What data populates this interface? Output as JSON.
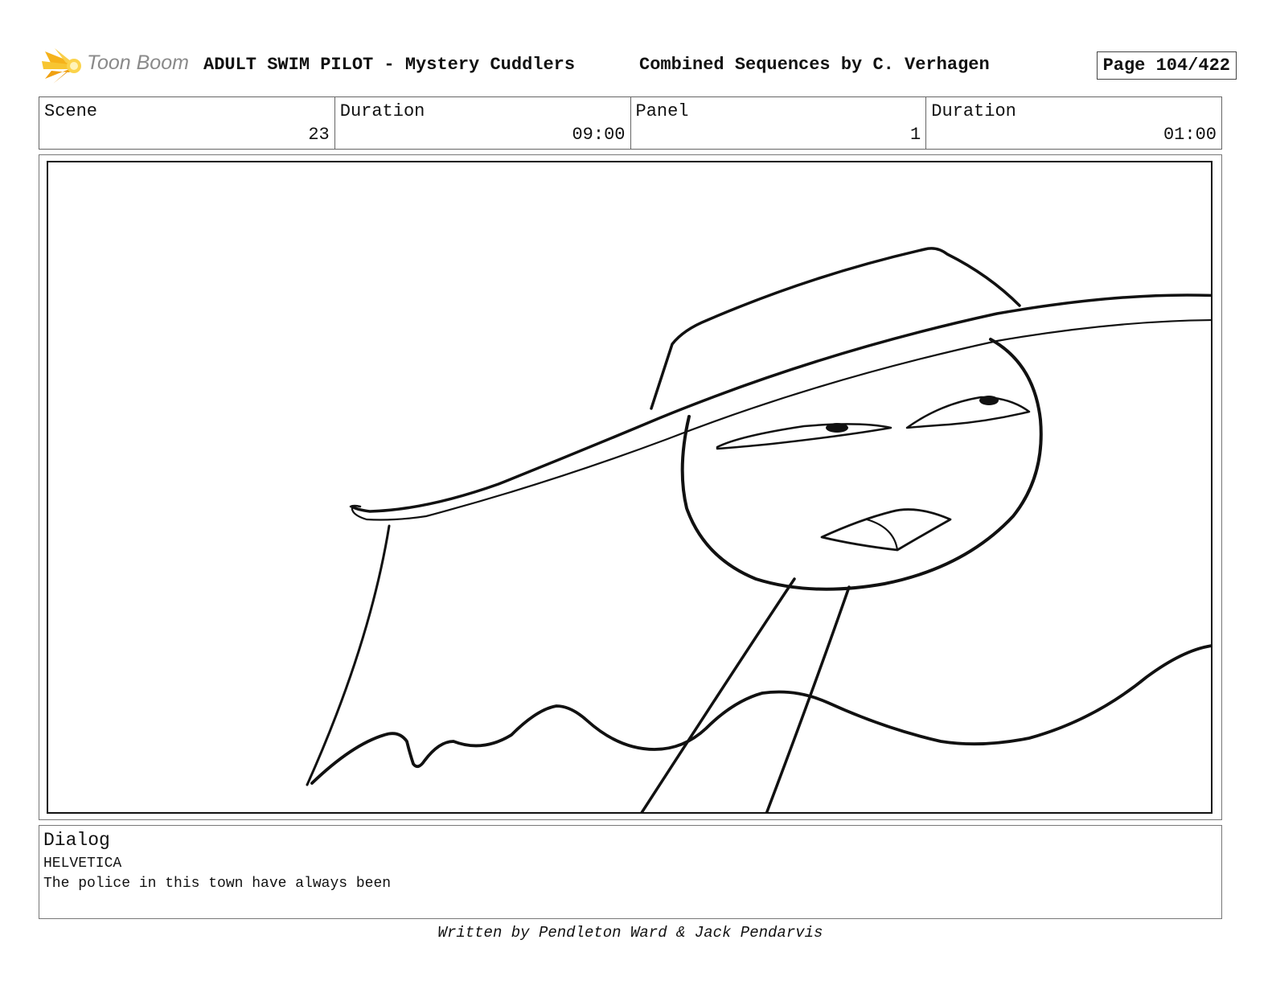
{
  "header": {
    "logo_text": "Toon Boom",
    "title": "ADULT SWIM PILOT - Mystery Cuddlers",
    "sequence": "Combined Sequences by C. Verhagen",
    "page": "Page 104/422"
  },
  "info": {
    "scene_label": "Scene",
    "scene_value": "23",
    "scene_duration_label": "Duration",
    "scene_duration_value": "09:00",
    "panel_label": "Panel",
    "panel_value": "1",
    "panel_duration_label": "Duration",
    "panel_duration_value": "01:00"
  },
  "dialog": {
    "heading": "Dialog",
    "speaker": "HELVETICA",
    "line": "The police in this town have always been"
  },
  "footer": {
    "credit": "Written by Pendleton Ward & Jack Pendarvis"
  },
  "colors": {
    "logo_accent": "#f5b21a",
    "ink": "#111111"
  }
}
